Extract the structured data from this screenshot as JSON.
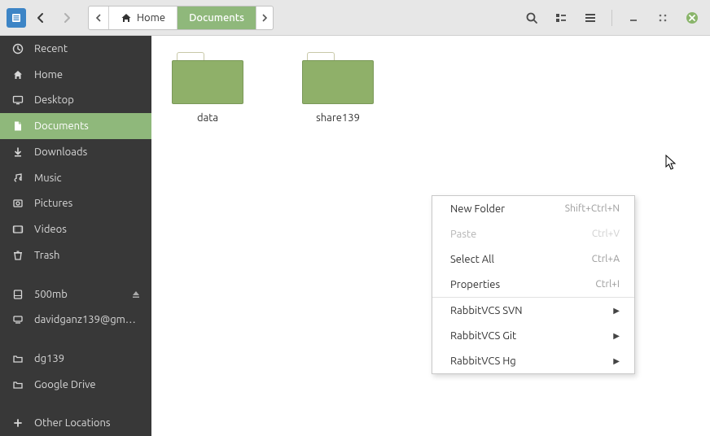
{
  "breadcrumb": {
    "home": "Home",
    "current": "Documents"
  },
  "sidebar": {
    "items": [
      {
        "label": "Recent",
        "icon": "clock"
      },
      {
        "label": "Home",
        "icon": "home"
      },
      {
        "label": "Desktop",
        "icon": "desktop"
      },
      {
        "label": "Documents",
        "icon": "document",
        "active": true
      },
      {
        "label": "Downloads",
        "icon": "download"
      },
      {
        "label": "Music",
        "icon": "music"
      },
      {
        "label": "Pictures",
        "icon": "pictures"
      },
      {
        "label": "Videos",
        "icon": "videos"
      },
      {
        "label": "Trash",
        "icon": "trash"
      }
    ],
    "mounts": [
      {
        "label": "500mb",
        "icon": "disk",
        "ejectable": true
      },
      {
        "label": "davidganz139@gm…",
        "icon": "network"
      }
    ],
    "bookmarks": [
      {
        "label": "dg139",
        "icon": "folder"
      },
      {
        "label": "Google Drive",
        "icon": "folder"
      }
    ],
    "other": {
      "label": "Other Locations",
      "icon": "plus"
    }
  },
  "folders": [
    {
      "label": "data"
    },
    {
      "label": "share139"
    }
  ],
  "context_menu": {
    "items": [
      {
        "label": "New Folder",
        "shortcut": "Shift+Ctrl+N"
      },
      {
        "label": "Paste",
        "shortcut": "Ctrl+V",
        "disabled": true
      },
      {
        "label": "Select All",
        "shortcut": "Ctrl+A"
      },
      {
        "label": "Properties",
        "shortcut": "Ctrl+I"
      }
    ],
    "submenus": [
      {
        "label": "RabbitVCS SVN"
      },
      {
        "label": "RabbitVCS Git"
      },
      {
        "label": "RabbitVCS Hg"
      }
    ]
  }
}
